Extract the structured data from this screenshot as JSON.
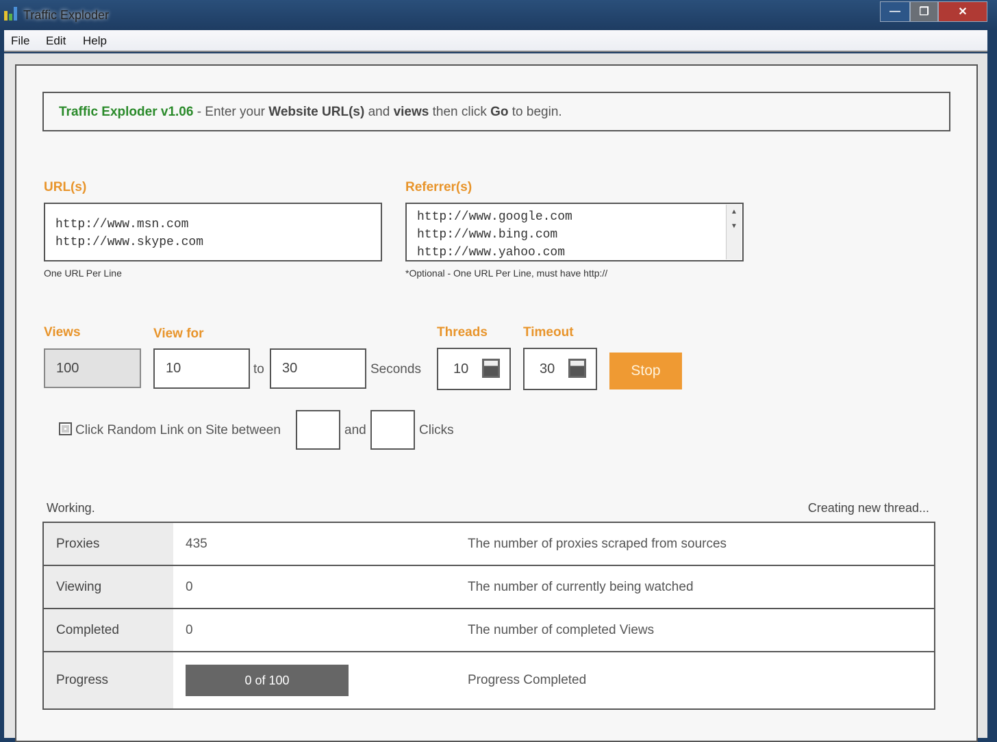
{
  "window": {
    "title": "Traffic Exploder",
    "minimize": "—",
    "maximize": "❐",
    "close": "✕"
  },
  "menu": [
    "File",
    "Edit",
    "Help"
  ],
  "header": {
    "app": "Traffic Exploder v1.06",
    "p1": " - Enter your ",
    "b1": "Website URL(s)",
    "p2": " and ",
    "b2": "views",
    "p3": " then click ",
    "b3": "Go",
    "p4": " to begin."
  },
  "urls": {
    "label": "URL(s)",
    "value": "http://www.msn.com\nhttp://www.skype.com",
    "hint": "One URL Per Line"
  },
  "referrers": {
    "label": "Referrer(s)",
    "value": "http://www.google.com\nhttp://www.bing.com\nhttp://www.yahoo.com",
    "hint": "*Optional - One URL Per Line, must have http://"
  },
  "views": {
    "label": "Views",
    "value": "100"
  },
  "view_for": {
    "label": "View for",
    "from": "10",
    "to_label": "to",
    "to": "30",
    "unit": "Seconds"
  },
  "threads": {
    "label": "Threads",
    "value": "10"
  },
  "timeout": {
    "label": "Timeout",
    "value": "30"
  },
  "stop_label": "Stop",
  "click_random": {
    "label": "Click Random Link on Site between",
    "and": "and",
    "min": "",
    "max": "",
    "clicks": "Clicks",
    "checked": false
  },
  "status": {
    "left": "Working.",
    "right": "Creating new thread..."
  },
  "stats": [
    {
      "key": "Proxies",
      "value": "435",
      "desc": "The number of proxies scraped from sources"
    },
    {
      "key": "Viewing",
      "value": "0",
      "desc": "The number of currently being watched"
    },
    {
      "key": "Completed",
      "value": "0",
      "desc": "The number of completed Views"
    }
  ],
  "progress": {
    "key": "Progress",
    "text": "0 of 100",
    "fraction": 0,
    "desc": "Progress Completed"
  }
}
